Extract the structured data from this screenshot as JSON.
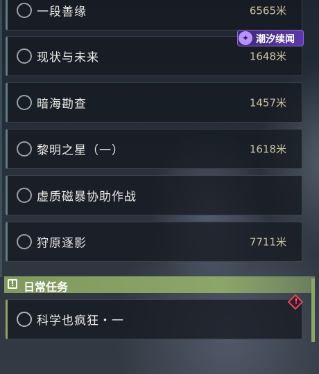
{
  "quests": [
    {
      "title": "一段善缘",
      "distance": "6565米"
    },
    {
      "title": "现状与未来",
      "distance": "1648米"
    },
    {
      "title": "暗海勘查",
      "distance": "1457米"
    },
    {
      "title": "黎明之星（一）",
      "distance": "1618米"
    },
    {
      "title": "虚质磁暴协助作战",
      "distance": ""
    },
    {
      "title": "狩原逐影",
      "distance": "7711米"
    }
  ],
  "event_tag": {
    "label": "潮汐续闻",
    "icon": "tide-swirl-icon"
  },
  "daily_section": {
    "label": "日常任务",
    "icon": "exclamation-box-icon"
  },
  "daily_quests": [
    {
      "title": "科学也疯狂・一",
      "alert_icon": "alert-diamond-icon"
    }
  ],
  "colors": {
    "daily_accent": "#8ba668",
    "tag_purple": "#5c3aa8",
    "distance_text": "#cfc3a2",
    "alert_red": "#e04a5a"
  }
}
